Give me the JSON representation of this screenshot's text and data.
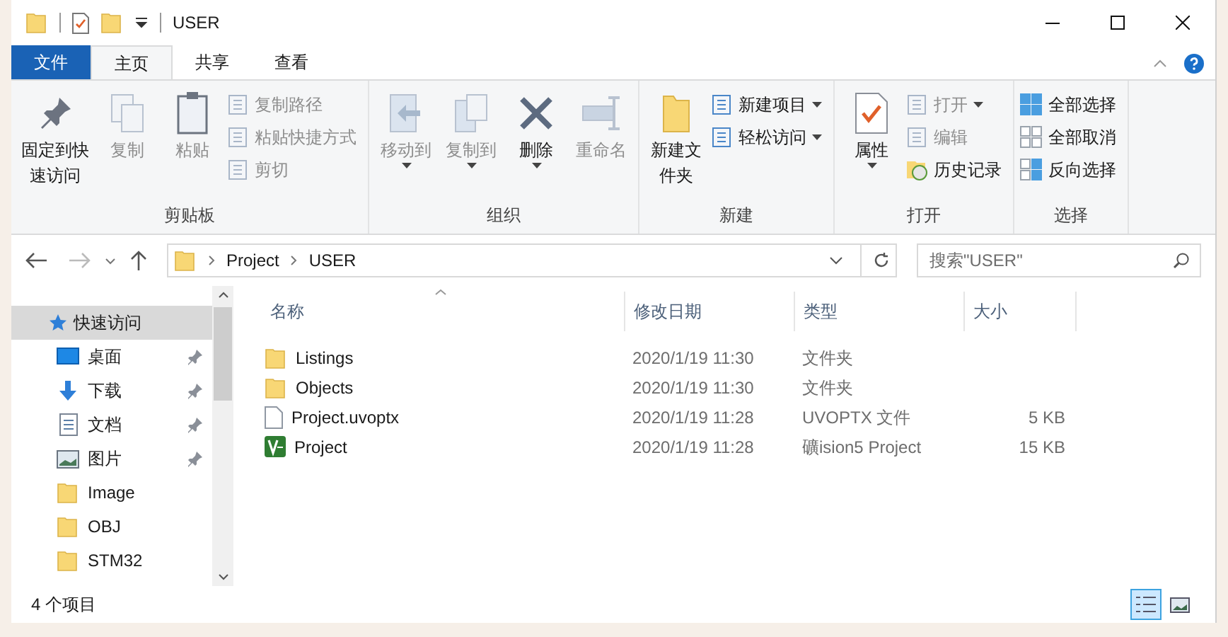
{
  "window": {
    "title": "USER"
  },
  "ribbon_tabs": [
    {
      "label": "文件",
      "kind": "file",
      "selected": false
    },
    {
      "label": "主页",
      "kind": "tab",
      "selected": true
    },
    {
      "label": "共享",
      "kind": "tab",
      "selected": false
    },
    {
      "label": "查看",
      "kind": "tab",
      "selected": false
    }
  ],
  "ribbon_groups": [
    {
      "label": "剪贴板",
      "items": [
        {
          "kind": "big",
          "label": "固定到快速访问",
          "disabled": false,
          "dropdown": false
        },
        {
          "kind": "big",
          "label": "复制",
          "disabled": true,
          "dropdown": false
        },
        {
          "kind": "big",
          "label": "粘贴",
          "disabled": true,
          "dropdown": false
        },
        {
          "kind": "small",
          "label": "复制路径",
          "disabled": true,
          "dropdown": false
        },
        {
          "kind": "small",
          "label": "粘贴快捷方式",
          "disabled": true,
          "dropdown": false
        },
        {
          "kind": "small",
          "label": "剪切",
          "disabled": true,
          "dropdown": false
        }
      ]
    },
    {
      "label": "组织",
      "items": [
        {
          "kind": "big",
          "label": "移动到",
          "disabled": true,
          "dropdown": true
        },
        {
          "kind": "big",
          "label": "复制到",
          "disabled": true,
          "dropdown": true
        },
        {
          "kind": "big",
          "label": "删除",
          "disabled": false,
          "dropdown": true
        },
        {
          "kind": "big",
          "label": "重命名",
          "disabled": true,
          "dropdown": false
        }
      ]
    },
    {
      "label": "新建",
      "items": [
        {
          "kind": "big",
          "label": "新建文件夹",
          "disabled": false,
          "dropdown": false
        },
        {
          "kind": "small",
          "label": "新建项目",
          "disabled": false,
          "dropdown": true
        },
        {
          "kind": "small",
          "label": "轻松访问",
          "disabled": false,
          "dropdown": true
        }
      ]
    },
    {
      "label": "打开",
      "items": [
        {
          "kind": "big",
          "label": "属性",
          "disabled": false,
          "dropdown": true
        },
        {
          "kind": "small",
          "label": "打开",
          "disabled": true,
          "dropdown": true
        },
        {
          "kind": "small",
          "label": "编辑",
          "disabled": true,
          "dropdown": false
        },
        {
          "kind": "small",
          "label": "历史记录",
          "disabled": false,
          "dropdown": false
        }
      ]
    },
    {
      "label": "选择",
      "items": [
        {
          "kind": "small",
          "label": "全部选择",
          "disabled": false,
          "dropdown": false
        },
        {
          "kind": "small",
          "label": "全部取消",
          "disabled": false,
          "dropdown": false
        },
        {
          "kind": "small",
          "label": "反向选择",
          "disabled": false,
          "dropdown": false
        }
      ]
    }
  ],
  "address_bar": {
    "path": [
      "Project",
      "USER"
    ]
  },
  "search": {
    "placeholder": "搜索\"USER\""
  },
  "sidebar": {
    "items": [
      {
        "label": "快速访问",
        "kind": "star",
        "selected": true,
        "children": [
          {
            "label": "桌面",
            "kind": "desktop",
            "pinned": true,
            "selected": false
          },
          {
            "label": "下载",
            "kind": "download",
            "pinned": true,
            "selected": false
          },
          {
            "label": "文档",
            "kind": "document",
            "pinned": true,
            "selected": false
          },
          {
            "label": "图片",
            "kind": "picture",
            "pinned": true,
            "selected": false
          },
          {
            "label": "Image",
            "kind": "folder",
            "pinned": false,
            "selected": false
          },
          {
            "label": "OBJ",
            "kind": "folder",
            "pinned": false,
            "selected": false
          },
          {
            "label": "STM32",
            "kind": "folder",
            "pinned": false,
            "selected": false
          }
        ]
      }
    ]
  },
  "table": {
    "columns": [
      "名称",
      "修改日期",
      "类型",
      "大小"
    ],
    "rows": [
      {
        "kind": "folder",
        "name": "Listings",
        "date": "2020/1/19 11:30",
        "type": "文件夹",
        "size": ""
      },
      {
        "kind": "folder",
        "name": "Objects",
        "date": "2020/1/19 11:30",
        "type": "文件夹",
        "size": ""
      },
      {
        "kind": "file",
        "name": "Project.uvoptx",
        "date": "2020/1/19 11:28",
        "type": "UVOPTX 文件",
        "size": "5 KB"
      },
      {
        "kind": "project",
        "name": "Project",
        "date": "2020/1/19 11:28",
        "type": "礦ision5 Project",
        "size": "15 KB"
      }
    ]
  },
  "status_bar": {
    "count": "4 个项目"
  },
  "view_buttons": [
    {
      "kind": "details",
      "selected": true
    },
    {
      "kind": "large",
      "selected": false
    }
  ]
}
